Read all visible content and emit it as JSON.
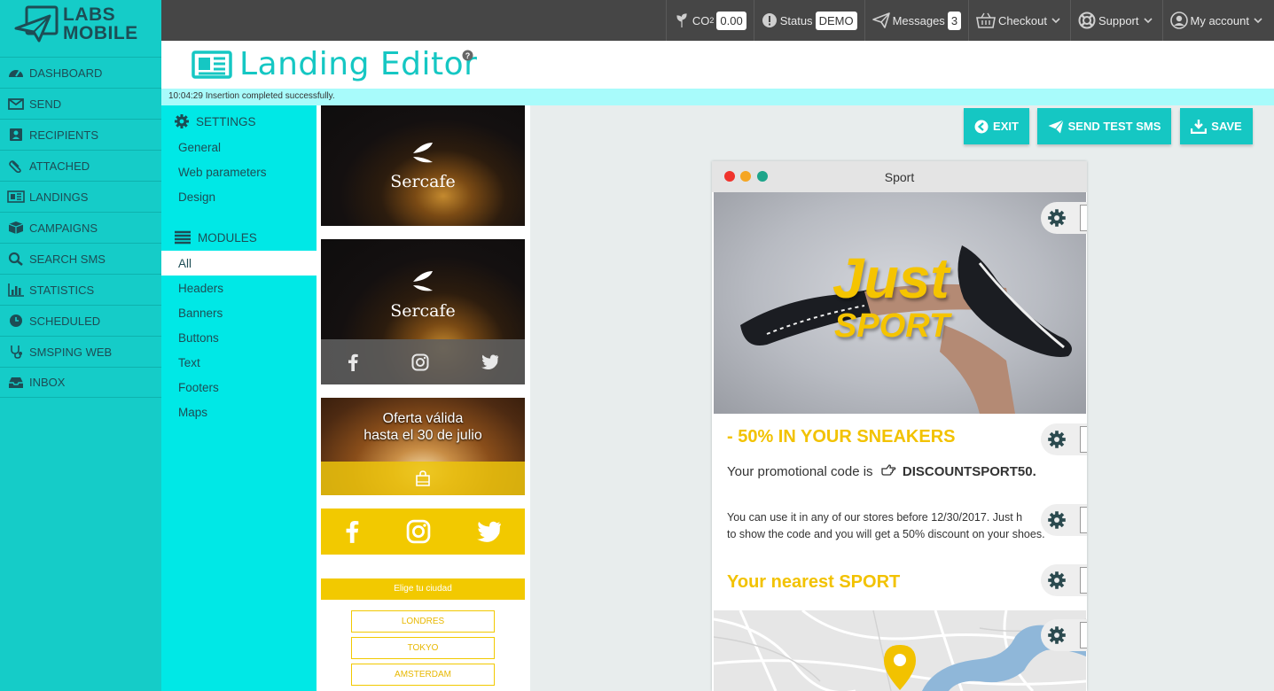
{
  "brand": {
    "line1": "LABS",
    "line2": "MOBILE"
  },
  "sidebar": {
    "items": [
      {
        "label": "DASHBOARD",
        "icon": "dashboard-icon"
      },
      {
        "label": "SEND",
        "icon": "envelope-icon"
      },
      {
        "label": "RECIPIENTS",
        "icon": "contacts-icon"
      },
      {
        "label": "ATTACHED",
        "icon": "paperclip-icon"
      },
      {
        "label": "LANDINGS",
        "icon": "newspaper-icon"
      },
      {
        "label": "CAMPAIGNS",
        "icon": "box-icon"
      },
      {
        "label": "SEARCH SMS",
        "icon": "search-icon"
      },
      {
        "label": "STATISTICS",
        "icon": "bar-chart-icon"
      },
      {
        "label": "SCHEDULED",
        "icon": "clock-icon"
      },
      {
        "label": "SMSPING WEB",
        "icon": "stethoscope-icon"
      },
      {
        "label": "INBOX",
        "icon": "inbox-icon"
      }
    ]
  },
  "topbar": {
    "co2_label": "CO",
    "co2_sub": "2",
    "co2_value": "0.00",
    "status_label": "Status",
    "status_value": "DEMO",
    "messages_label": "Messages",
    "messages_count": "3",
    "checkout_label": "Checkout",
    "support_label": "Support",
    "account_label": "My account"
  },
  "header": {
    "title": "Landing Editor"
  },
  "status_bar": {
    "time": "10:04:29",
    "message": "Insertion completed successfully."
  },
  "settings": {
    "title": "SETTINGS",
    "items": [
      "General",
      "Web parameters",
      "Design"
    ]
  },
  "modules": {
    "title": "MODULES",
    "items": [
      "All",
      "Headers",
      "Banners",
      "Buttons",
      "Text",
      "Footers",
      "Maps"
    ],
    "active": "All"
  },
  "thumbnails": {
    "brand_name": "Sercafe",
    "offer_line1": "Oferta válida",
    "offer_line2": "hasta el 30 de julio",
    "city_prompt": "Elige tu ciudad",
    "cities": [
      "LONDRES",
      "TOKYO",
      "AMSTERDAM"
    ]
  },
  "actions": {
    "exit_label": "EXIT",
    "send_test_label": "SEND TEST SMS",
    "save_label": "SAVE"
  },
  "preview": {
    "window_title": "Sport",
    "hero_word1": "Just",
    "hero_word2": "SPORT",
    "promo_heading": "- 50% IN YOUR SNEAKERS",
    "promo_code_prefix": "Your promotional code is",
    "promo_code": "DISCOUNTSPORT50.",
    "promo_desc_line1": "You can use it in any of our stores before 12/30/2017. Just h",
    "promo_desc_line2": "to show the code and you will get a 50% discount on your shoes.",
    "nearest_heading": "Your nearest SPORT"
  },
  "colors": {
    "sidebar": "#15ccc8",
    "settings_panel": "#00e8e6",
    "topbar": "#464646",
    "accent": "#15c7c3",
    "promo_yellow": "#f2c200",
    "status_bar": "#a8fbfb"
  }
}
